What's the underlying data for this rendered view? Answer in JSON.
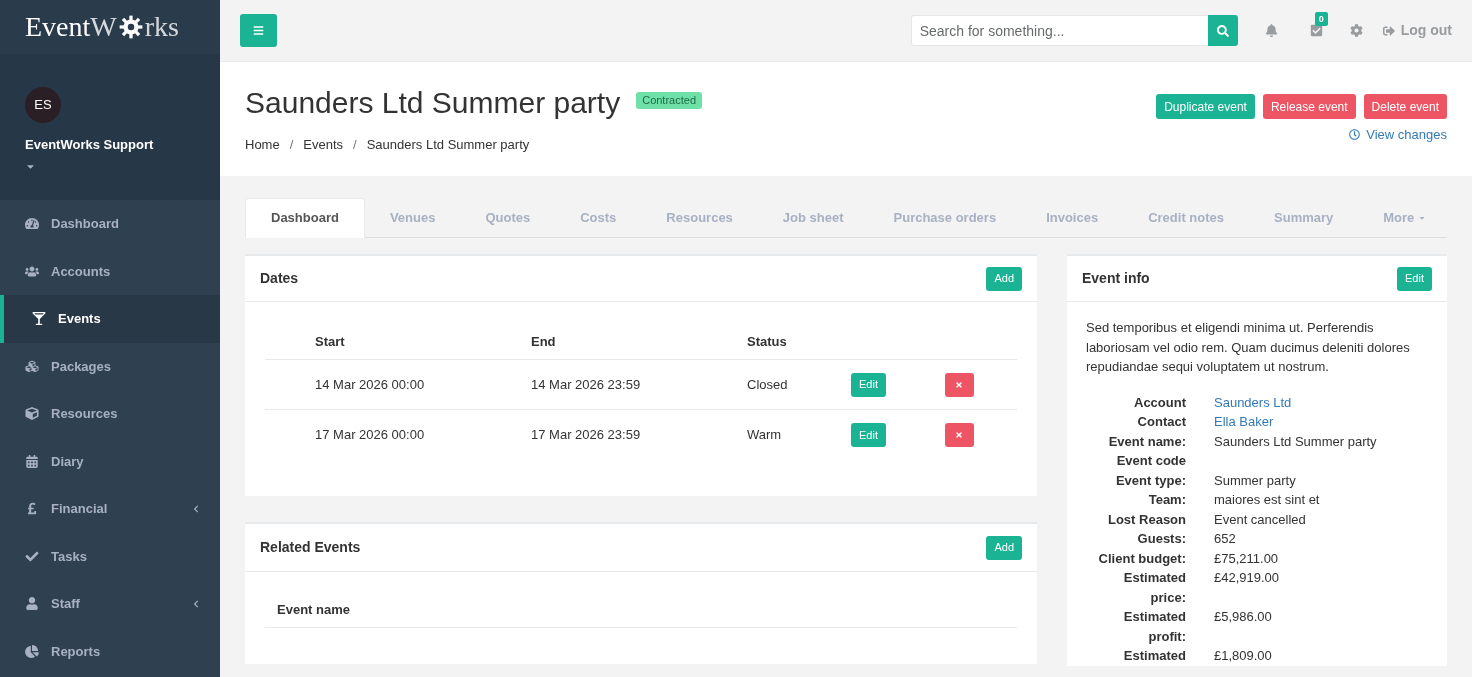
{
  "brand": {
    "name_a": "Event",
    "name_b": "W",
    "name_c": "rks"
  },
  "user": {
    "initials": "ES",
    "name": "EventWorks Support"
  },
  "sidebar": {
    "items": [
      {
        "label": "Dashboard",
        "selected": false,
        "submenu": false
      },
      {
        "label": "Accounts",
        "selected": false,
        "submenu": false
      },
      {
        "label": "Events",
        "selected": true,
        "submenu": false
      },
      {
        "label": "Packages",
        "selected": false,
        "submenu": false
      },
      {
        "label": "Resources",
        "selected": false,
        "submenu": false
      },
      {
        "label": "Diary",
        "selected": false,
        "submenu": false
      },
      {
        "label": "Financial",
        "selected": false,
        "submenu": true
      },
      {
        "label": "Tasks",
        "selected": false,
        "submenu": false
      },
      {
        "label": "Staff",
        "selected": false,
        "submenu": true
      },
      {
        "label": "Reports",
        "selected": false,
        "submenu": false
      }
    ]
  },
  "topbar": {
    "search_placeholder": "Search for something...",
    "tasks_count": "0",
    "logout": "Log out"
  },
  "page": {
    "title": "Saunders Ltd Summer party",
    "status": "Contracted",
    "breadcrumb": [
      "Home",
      "Events",
      "Saunders Ltd Summer party"
    ],
    "breadcrumb_separator": "/",
    "actions": [
      {
        "label": "Duplicate event",
        "kind": "primary"
      },
      {
        "label": "Release event",
        "kind": "danger"
      },
      {
        "label": "Delete event",
        "kind": "danger"
      }
    ],
    "view_changes": "View changes"
  },
  "tabs": [
    {
      "label": "Dashboard",
      "selected": true
    },
    {
      "label": "Venues",
      "selected": false
    },
    {
      "label": "Quotes",
      "selected": false
    },
    {
      "label": "Costs",
      "selected": false
    },
    {
      "label": "Resources",
      "selected": false
    },
    {
      "label": "Job sheet",
      "selected": false
    },
    {
      "label": "Purchase orders",
      "selected": false
    },
    {
      "label": "Invoices",
      "selected": false
    },
    {
      "label": "Credit notes",
      "selected": false
    },
    {
      "label": "Summary",
      "selected": false
    },
    {
      "label": "More",
      "selected": false
    }
  ],
  "dates": {
    "title": "Dates",
    "add": "Add",
    "columns": [
      "Start",
      "End",
      "Status"
    ],
    "rows": [
      {
        "start": "14 Mar 2026 00:00",
        "end": "14 Mar 2026 23:59",
        "status": "Closed",
        "edit": "Edit"
      },
      {
        "start": "17 Mar 2026 00:00",
        "end": "17 Mar 2026 23:59",
        "status": "Warm",
        "edit": "Edit"
      }
    ]
  },
  "related": {
    "title": "Related Events",
    "add": "Add",
    "columns": [
      "Event name"
    ]
  },
  "event_info": {
    "title": "Event info",
    "edit": "Edit",
    "description": "Sed temporibus et eligendi minima ut. Perferendis laboriosam vel odio rem. Quam ducimus deleniti dolores repudiandae sequi voluptatem ut nostrum.",
    "fields": [
      {
        "label": "Account",
        "value": "Saunders Ltd",
        "kind": "link"
      },
      {
        "label": "Contact",
        "value": "Ella Baker",
        "kind": "link"
      },
      {
        "label": "Event name:",
        "value": "Saunders Ltd Summer party",
        "kind": "text"
      },
      {
        "label": "Event code"
      },
      {
        "label": "Event type:",
        "value": "Summer party",
        "kind": "text"
      },
      {
        "label": "Team:",
        "value": "maiores est sint et",
        "kind": "text"
      },
      {
        "label": "Lost Reason",
        "value": "Event cancelled",
        "kind": "text"
      },
      {
        "label": "Guests:",
        "value": "652",
        "kind": "text"
      },
      {
        "label": "Client budget:",
        "value": "£75,211.00",
        "kind": "text"
      },
      {
        "label": "Estimated price:",
        "value": "£42,919.00",
        "kind": "text"
      },
      {
        "label": "Estimated profit:",
        "value": "£5,986.00",
        "kind": "text"
      },
      {
        "label": "Estimated",
        "value": "£1,809.00",
        "kind": "text"
      }
    ]
  }
}
